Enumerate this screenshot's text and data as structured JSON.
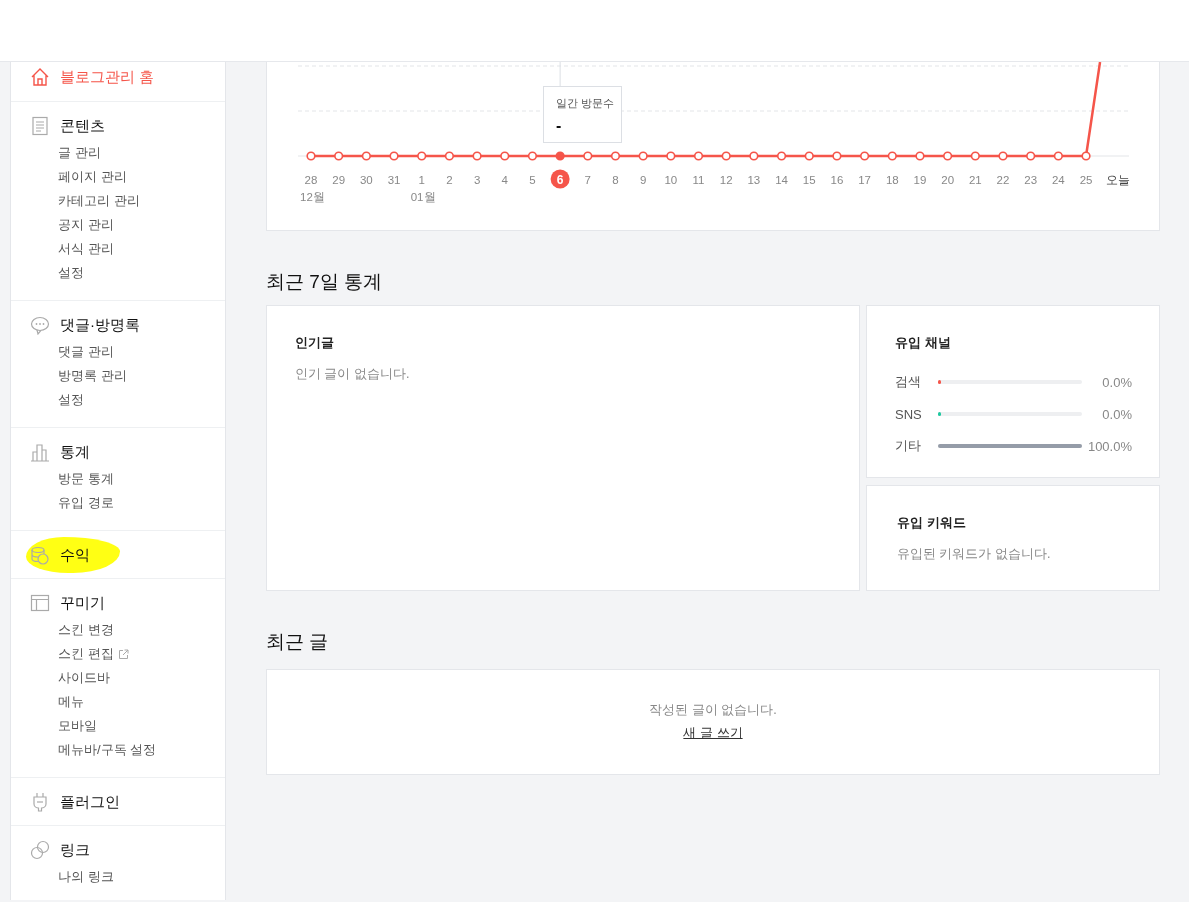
{
  "sidebar": {
    "sections": [
      {
        "title": "블로그관리 홈",
        "kind": "home",
        "active": true,
        "highlighted": false
      },
      {
        "title": "콘텐츠",
        "kind": "document",
        "active": false,
        "highlighted": false,
        "items": [
          {
            "label": "글 관리",
            "external": false
          },
          {
            "label": "페이지 관리",
            "external": false
          },
          {
            "label": "카테고리 관리",
            "external": false
          },
          {
            "label": "공지 관리",
            "external": false
          },
          {
            "label": "서식 관리",
            "external": false
          },
          {
            "label": "설정",
            "external": false
          }
        ]
      },
      {
        "title": "댓글·방명록",
        "kind": "comment",
        "active": false,
        "highlighted": false,
        "items": [
          {
            "label": "댓글 관리",
            "external": false
          },
          {
            "label": "방명록 관리",
            "external": false
          },
          {
            "label": "설정",
            "external": false
          }
        ]
      },
      {
        "title": "통계",
        "kind": "chart",
        "active": false,
        "highlighted": false,
        "items": [
          {
            "label": "방문 통계",
            "external": false
          },
          {
            "label": "유입 경로",
            "external": false
          }
        ]
      },
      {
        "title": "수익",
        "kind": "coins",
        "active": false,
        "highlighted": true
      },
      {
        "title": "꾸미기",
        "kind": "layout",
        "active": false,
        "highlighted": false,
        "items": [
          {
            "label": "스킨 변경",
            "external": false
          },
          {
            "label": "스킨 편집",
            "external": true
          },
          {
            "label": "사이드바",
            "external": false
          },
          {
            "label": "메뉴",
            "external": false
          },
          {
            "label": "모바일",
            "external": false
          },
          {
            "label": "메뉴바/구독 설정",
            "external": false
          }
        ]
      },
      {
        "title": "플러그인",
        "kind": "plug",
        "active": false,
        "highlighted": false
      },
      {
        "title": "링크",
        "kind": "link",
        "active": false,
        "highlighted": false,
        "items": [
          {
            "label": "나의 링크",
            "external": false
          }
        ]
      }
    ]
  },
  "visit_chart": {
    "x_labels": [
      {
        "label": "28",
        "month": "12월",
        "selected": false
      },
      {
        "label": "29",
        "selected": false
      },
      {
        "label": "30",
        "selected": false
      },
      {
        "label": "31",
        "selected": false
      },
      {
        "label": "1",
        "month": "01월",
        "selected": false
      },
      {
        "label": "2",
        "selected": false
      },
      {
        "label": "3",
        "selected": false
      },
      {
        "label": "4",
        "selected": false
      },
      {
        "label": "5",
        "selected": false
      },
      {
        "label": "6",
        "selected": true
      },
      {
        "label": "7",
        "selected": false
      },
      {
        "label": "8",
        "selected": false
      },
      {
        "label": "9",
        "selected": false
      },
      {
        "label": "10",
        "selected": false
      },
      {
        "label": "11",
        "selected": false
      },
      {
        "label": "12",
        "selected": false
      },
      {
        "label": "13",
        "selected": false
      },
      {
        "label": "14",
        "selected": false
      },
      {
        "label": "15",
        "selected": false
      },
      {
        "label": "16",
        "selected": false
      },
      {
        "label": "17",
        "selected": false
      },
      {
        "label": "18",
        "selected": false
      },
      {
        "label": "19",
        "selected": false
      },
      {
        "label": "20",
        "selected": false
      },
      {
        "label": "21",
        "selected": false
      },
      {
        "label": "22",
        "selected": false
      },
      {
        "label": "23",
        "selected": false
      },
      {
        "label": "24",
        "selected": false
      },
      {
        "label": "25",
        "selected": false
      },
      {
        "label": "오늘",
        "selected": false
      }
    ],
    "tooltip": {
      "title": "일간 방문수",
      "value": "-"
    }
  },
  "weekly_stats": {
    "title": "최근 7일 통계",
    "popular_posts": {
      "title": "인기글",
      "empty_text": "인기 글이 없습니다."
    },
    "channels": {
      "title": "유입 채널",
      "rows": [
        {
          "name": "검색",
          "level": 0,
          "reading": "0.0%",
          "color": "#f5554a"
        },
        {
          "name": "SNS",
          "level": 0,
          "reading": "0.0%",
          "color": "#1ec8a0"
        },
        {
          "name": "기타",
          "level": 1,
          "reading": "100.0%",
          "color": "#959ca8"
        }
      ]
    },
    "keywords": {
      "title": "유입 키워드",
      "empty_text": "유입된 키워드가 없습니다."
    }
  },
  "recent_posts": {
    "title": "최근 글",
    "empty_text": "작성된 글이 없습니다.",
    "link": "새 글 쓰기"
  }
}
